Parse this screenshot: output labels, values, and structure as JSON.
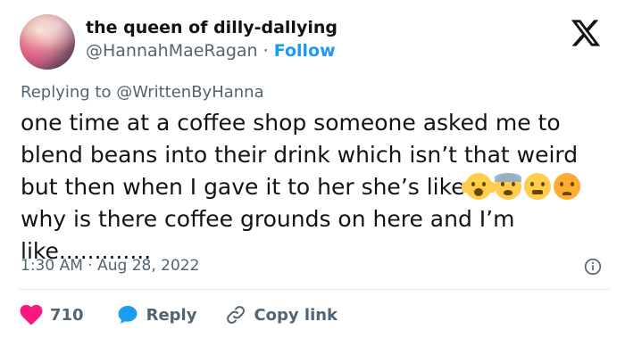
{
  "author": {
    "display_name": "the queen of dilly-dallying",
    "handle": "@HannahMaeRagan",
    "separator": "·",
    "follow_label": "Follow"
  },
  "replying": {
    "prefix": "Replying to",
    "mention": "@WrittenByHanna"
  },
  "tweet": {
    "line1": "one time at a coffee shop someone asked me to",
    "line2": "blend beans into their drink which isn’t that weird",
    "line3": "but then when I gave it to her she’s like",
    "line4": "why is there coffee grounds on here and I’m",
    "line5": "like............."
  },
  "emojis": [
    "face-screaming-in-fear",
    "anxious-face-with-sweat",
    "face-with-steam-from-nose",
    "angry-face"
  ],
  "meta": {
    "time": "1:30 AM",
    "separator": "·",
    "date": "Aug 28, 2022"
  },
  "actions": {
    "like_count": "710",
    "reply_label": "Reply",
    "copy_link_label": "Copy link"
  },
  "colors": {
    "text": "#0f1419",
    "secondary": "#536471",
    "accent": "#1d9bf0",
    "like": "#f91880",
    "divider": "#e1e8ed"
  },
  "icons": [
    "x-logo-icon",
    "info-icon",
    "heart-icon",
    "reply-bubble-icon",
    "link-icon"
  ]
}
